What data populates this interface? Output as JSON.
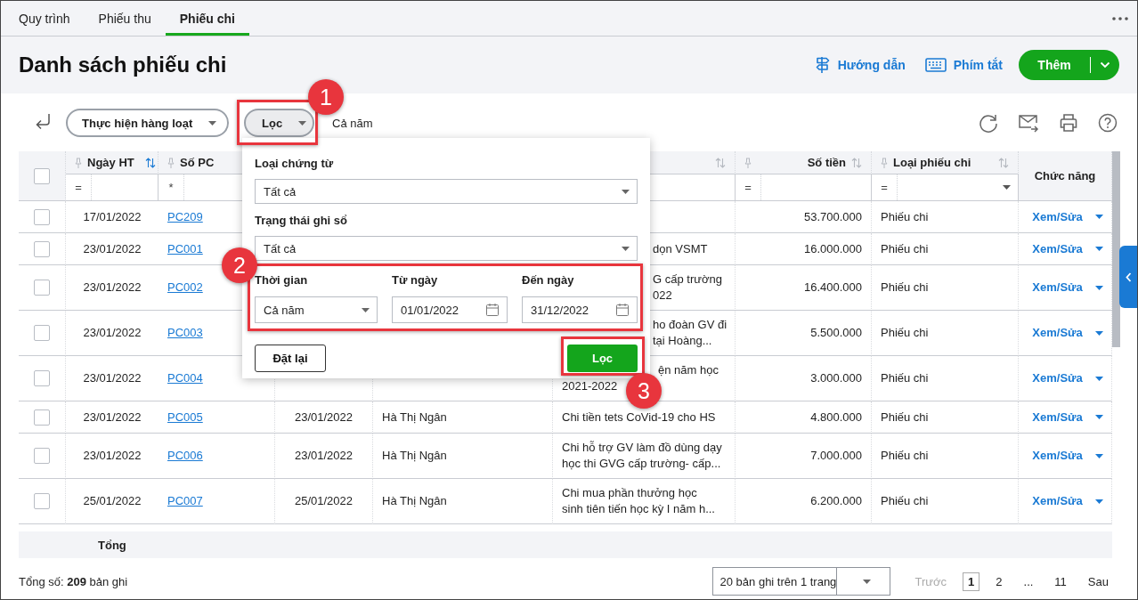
{
  "tabs": [
    {
      "label": "Quy trình",
      "selected": false
    },
    {
      "label": "Phiếu thu",
      "selected": false
    },
    {
      "label": "Phiếu chi",
      "selected": true
    }
  ],
  "page_title": "Danh sách phiếu chi",
  "header_actions": {
    "guide": "Hướng dẫn",
    "shortcuts": "Phím tắt",
    "add": "Thêm"
  },
  "toolbar": {
    "bulk_action": "Thực hiện hàng loạt",
    "filter": "Lọc",
    "period": "Cả năm"
  },
  "table": {
    "select_all": {
      "checked": false
    },
    "columns": [
      {
        "label": "Ngày HT",
        "sorted": true,
        "operator": "="
      },
      {
        "label": "Số PC",
        "operator": "*"
      },
      {},
      {},
      {
        "sorted": false
      },
      {
        "label": "Số tiền",
        "sorted": false,
        "operator": "="
      },
      {
        "label": "Loại phiếu chi",
        "sorted": false,
        "operator": "=",
        "dropdown": true
      },
      {
        "label": "Chức năng"
      }
    ],
    "rows": [
      {
        "checked": false,
        "posting_date": "17/01/2022",
        "voucher_no": "PC209",
        "amount": "53.700.000",
        "type": "Phiếu chi",
        "action": "Xem/Sửa"
      },
      {
        "checked": false,
        "posting_date": "23/01/2022",
        "voucher_no": "PC001",
        "description": [
          "dọn VSMT"
        ],
        "amount": "16.000.000",
        "type": "Phiếu chi",
        "action": "Xem/Sửa"
      },
      {
        "checked": false,
        "posting_date": "23/01/2022",
        "voucher_no": "PC002",
        "description": [
          "G cấp trường",
          "022"
        ],
        "amount": "16.400.000",
        "type": "Phiếu chi",
        "action": "Xem/Sửa"
      },
      {
        "checked": false,
        "posting_date": "23/01/2022",
        "voucher_no": "PC003",
        "description": [
          "ho đoàn GV đi",
          "tại Hoàng..."
        ],
        "amount": "5.500.000",
        "type": "Phiếu chi",
        "action": "Xem/Sửa"
      },
      {
        "checked": false,
        "posting_date": "23/01/2022",
        "voucher_no": "PC004",
        "description": [
          "ện năm học",
          "2021-2022"
        ],
        "amount": "3.000.000",
        "type": "Phiếu chi",
        "action": "Xem/Sửa"
      },
      {
        "checked": false,
        "posting_date": "23/01/2022",
        "voucher_no": "PC005",
        "voucher_date": "23/01/2022",
        "payee": "Hà Thị Ngân",
        "description": [
          "Chi tiền tets CoVid-19 cho HS"
        ],
        "amount": "4.800.000",
        "type": "Phiếu chi",
        "action": "Xem/Sửa"
      },
      {
        "checked": false,
        "posting_date": "23/01/2022",
        "voucher_no": "PC006",
        "voucher_date": "23/01/2022",
        "payee": "Hà Thị Ngân",
        "description": [
          "Chi hỗ trợ GV làm đồ dùng dạy",
          "học thi GVG cấp trường- cấp..."
        ],
        "amount": "7.000.000",
        "type": "Phiếu chi",
        "action": "Xem/Sửa"
      },
      {
        "checked": false,
        "posting_date": "25/01/2022",
        "voucher_no": "PC007",
        "voucher_date": "25/01/2022",
        "payee": "Hà Thị Ngân",
        "description": [
          "Chi mua phần thưởng học",
          "sinh tiên tiến học kỳ I năm h..."
        ],
        "amount": "6.200.000",
        "type": "Phiếu chi",
        "action": "Xem/Sửa"
      }
    ],
    "total_label": "Tổng"
  },
  "filter_panel": {
    "fields": [
      {
        "kind": "select",
        "label": "Loại chứng từ",
        "value": "Tất cả"
      },
      {
        "kind": "select",
        "label": "Trạng thái ghi sổ",
        "value": "Tất cả"
      }
    ],
    "period": [
      {
        "kind": "select",
        "label": "Thời gian",
        "value": "Cả năm"
      },
      {
        "kind": "date",
        "label": "Từ ngày",
        "value": "01/01/2022"
      },
      {
        "kind": "date",
        "label": "Đến ngày",
        "value": "31/12/2022"
      }
    ],
    "reset": "Đặt lại",
    "apply": "Lọc"
  },
  "annotations": [
    {
      "label": "1"
    },
    {
      "label": "2"
    },
    {
      "label": "3"
    }
  ],
  "footer": {
    "record_count": "Tổng số: **209** bản ghi",
    "page_size": "20 bản ghi trên 1 trang",
    "prev": {
      "label": "Trước",
      "disabled": true
    },
    "pages": [
      {
        "label": "1",
        "selected": true
      },
      {
        "label": "2",
        "selected": false
      },
      {
        "label": "...",
        "selected": false
      },
      {
        "label": "11",
        "selected": false
      }
    ],
    "next": {
      "label": "Sau",
      "disabled": false
    }
  }
}
